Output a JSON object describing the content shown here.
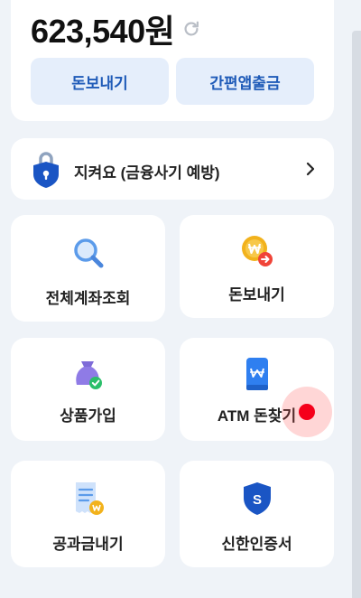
{
  "balance": {
    "amount": "623,540원"
  },
  "actions": {
    "send_label": "돈보내기",
    "easy_withdraw_label": "간편앱출금"
  },
  "banner": {
    "label": "지켜요 (금융사기 예방)"
  },
  "tiles": [
    {
      "label": "전체계좌조회",
      "icon": "magnifier-icon"
    },
    {
      "label": "돈보내기",
      "icon": "coin-send-icon"
    },
    {
      "label": "상품가입",
      "icon": "product-bag-icon"
    },
    {
      "label": "ATM 돈찾기",
      "icon": "atm-phone-icon"
    },
    {
      "label": "공과금내기",
      "icon": "bill-receipt-icon"
    },
    {
      "label": "신한인증서",
      "icon": "shield-s-icon"
    }
  ],
  "colors": {
    "background": "#eff3f8",
    "button_bg": "#e5eefb",
    "button_text": "#1f5bb8",
    "accent_blue": "#1a55c4",
    "coin_yellow": "#f2b21c",
    "alert_red": "#f04438",
    "check_green": "#2bbf6a"
  }
}
